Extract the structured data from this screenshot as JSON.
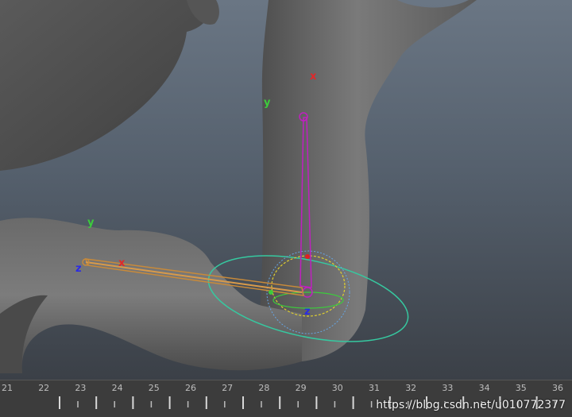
{
  "viewport": {
    "axis_labels": {
      "upper_x": "x",
      "upper_y": "y",
      "forearm_y": "y",
      "forearm_z": "z",
      "forearm_x": "x",
      "elbow_z": "z"
    },
    "colors": {
      "background_top": "#6a7684",
      "background_bottom": "#3b4047",
      "mesh": "#6e6e6e",
      "axis_x": "#e0282a",
      "axis_y": "#3ccc3c",
      "axis_z": "#2a2ae6",
      "bone_upper": "#c020c0",
      "bone_forearm": "#c88a3a",
      "manipulator_ring": "#36c9a0",
      "sphere_yellow": "#e0d030",
      "sphere_blue": "#66a6e6"
    }
  },
  "timeline": {
    "frames": [
      "21",
      "22",
      "23",
      "24",
      "25",
      "26",
      "27",
      "28",
      "29",
      "30",
      "31",
      "32",
      "33",
      "34",
      "35",
      "36"
    ]
  },
  "watermark": "https://blog.csdn.net/u010772377"
}
